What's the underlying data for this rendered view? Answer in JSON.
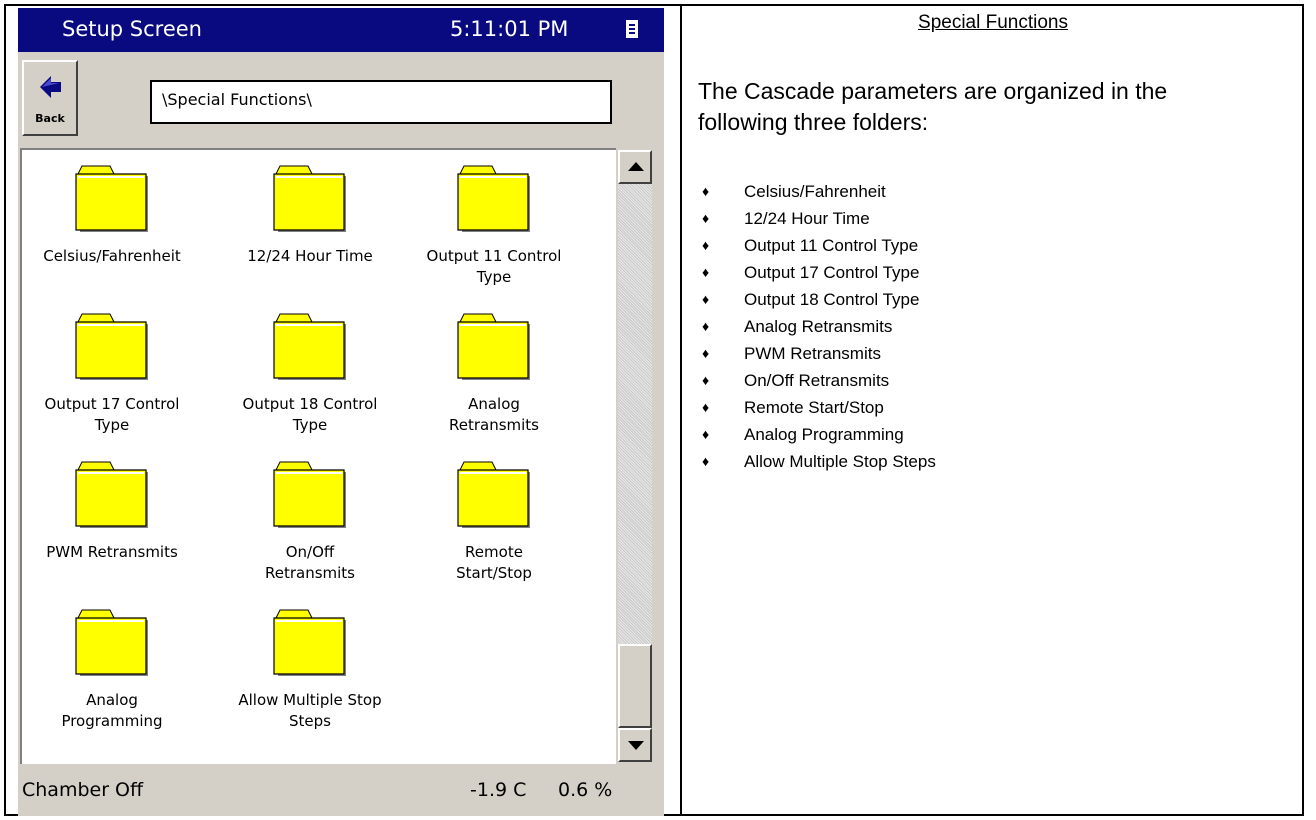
{
  "screen": {
    "title": "Setup Screen",
    "clock": "5:11:01 PM",
    "menu_icon": "menu-icon",
    "back_label": "Back",
    "path": "\\Special Functions\\",
    "folders": [
      {
        "label": "Celsius/Fahrenheit",
        "icon": "folder-icon"
      },
      {
        "label": "12/24 Hour Time",
        "icon": "folder-icon"
      },
      {
        "label": "Output 11 Control\nType",
        "icon": "folder-icon"
      },
      {
        "label": "Output 17 Control\nType",
        "icon": "folder-icon"
      },
      {
        "label": "Output 18 Control\nType",
        "icon": "folder-icon"
      },
      {
        "label": "Analog\nRetransmits",
        "icon": "folder-icon"
      },
      {
        "label": "PWM Retransmits",
        "icon": "folder-icon"
      },
      {
        "label": "On/Off\nRetransmits",
        "icon": "folder-icon"
      },
      {
        "label": "Remote\nStart/Stop",
        "icon": "folder-icon"
      },
      {
        "label": "Analog\nProgramming",
        "icon": "folder-icon"
      },
      {
        "label": "Allow Multiple Stop\nSteps",
        "icon": "folder-icon"
      }
    ],
    "status": {
      "chamber": "Chamber Off",
      "temperature": "-1.9 C",
      "percent": "0.6 %"
    },
    "colors": {
      "titlebar": "#0a0a80",
      "folder_fill": "#ffff00",
      "panel": "#d4d0c8"
    }
  },
  "description": {
    "heading": "Special Functions",
    "intro": "The Cascade parameters are organized in the following three folders:",
    "bullet_icon": "diamond-bullet-icon",
    "items": [
      "Celsius/Fahrenheit",
      "12/24 Hour Time",
      "Output 11 Control Type",
      "Output 17 Control Type",
      "Output 18 Control Type",
      "Analog Retransmits",
      "PWM Retransmits",
      "On/Off Retransmits",
      "Remote Start/Stop",
      "Analog Programming",
      "Allow Multiple Stop Steps"
    ]
  }
}
